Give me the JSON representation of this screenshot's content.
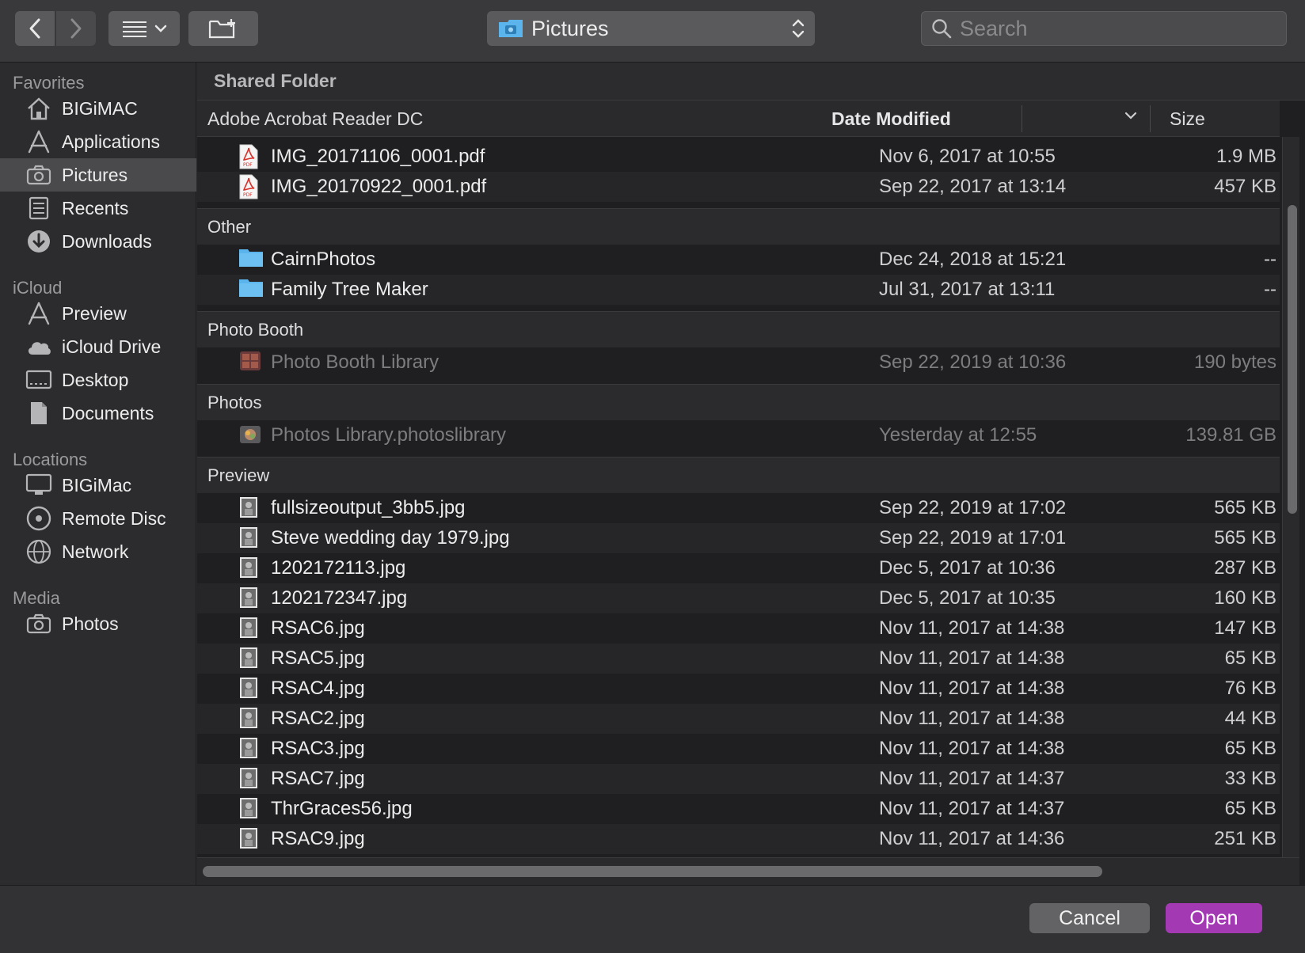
{
  "toolbar": {
    "path_label": "Pictures",
    "search_placeholder": "Search"
  },
  "sidebar": {
    "sections": [
      {
        "title": "Favorites",
        "items": [
          {
            "label": "BIGiMAC",
            "icon": "home-icon"
          },
          {
            "label": "Applications",
            "icon": "applications-icon"
          },
          {
            "label": "Pictures",
            "icon": "camera-icon",
            "selected": true
          },
          {
            "label": "Recents",
            "icon": "recents-icon"
          },
          {
            "label": "Downloads",
            "icon": "download-icon"
          }
        ]
      },
      {
        "title": "iCloud",
        "items": [
          {
            "label": "Preview",
            "icon": "applications-icon"
          },
          {
            "label": "iCloud Drive",
            "icon": "cloud-icon"
          },
          {
            "label": "Desktop",
            "icon": "desktop-icon"
          },
          {
            "label": "Documents",
            "icon": "document-icon"
          }
        ]
      },
      {
        "title": "Locations",
        "items": [
          {
            "label": "BIGiMac",
            "icon": "monitor-icon"
          },
          {
            "label": "Remote Disc",
            "icon": "disc-icon"
          },
          {
            "label": "Network",
            "icon": "globe-icon"
          }
        ]
      },
      {
        "title": "Media",
        "items": [
          {
            "label": "Photos",
            "icon": "camera-icon"
          }
        ]
      }
    ]
  },
  "main": {
    "location_header": "Shared Folder",
    "columns": {
      "name": "Adobe Acrobat Reader DC",
      "date": "Date Modified",
      "size": "Size"
    },
    "groups": [
      {
        "title": null,
        "rows": [
          {
            "name": "IMG_20171106_0001.pdf",
            "date": "Nov 6, 2017 at 10:55",
            "size": "1.9 MB",
            "icon": "pdf-icon"
          },
          {
            "name": "IMG_20170922_0001.pdf",
            "date": "Sep 22, 2017 at 13:14",
            "size": "457 KB",
            "icon": "pdf-icon"
          }
        ]
      },
      {
        "title": "Other",
        "rows": [
          {
            "name": "CairnPhotos",
            "date": "Dec 24, 2018 at 15:21",
            "size": "--",
            "icon": "folder-icon"
          },
          {
            "name": "Family Tree Maker",
            "date": "Jul 31, 2017 at 13:11",
            "size": "--",
            "icon": "folder-icon"
          }
        ]
      },
      {
        "title": "Photo Booth",
        "rows": [
          {
            "name": "Photo Booth Library",
            "date": "Sep 22, 2019 at 10:36",
            "size": "190 bytes",
            "icon": "photobooth-icon",
            "dim": true
          }
        ]
      },
      {
        "title": "Photos",
        "rows": [
          {
            "name": "Photos Library.photoslibrary",
            "date": "Yesterday at 12:55",
            "size": "139.81 GB",
            "icon": "photos-library-icon",
            "dim": true
          }
        ]
      },
      {
        "title": "Preview",
        "rows": [
          {
            "name": "fullsizeoutput_3bb5.jpg",
            "date": "Sep 22, 2019 at 17:02",
            "size": "565 KB",
            "icon": "image-thumb-icon"
          },
          {
            "name": "Steve wedding day 1979.jpg",
            "date": "Sep 22, 2019 at 17:01",
            "size": "565 KB",
            "icon": "image-thumb-icon"
          },
          {
            "name": "1202172113.jpg",
            "date": "Dec 5, 2017 at 10:36",
            "size": "287 KB",
            "icon": "image-thumb-icon"
          },
          {
            "name": "1202172347.jpg",
            "date": "Dec 5, 2017 at 10:35",
            "size": "160 KB",
            "icon": "image-thumb-icon"
          },
          {
            "name": "RSAC6.jpg",
            "date": "Nov 11, 2017 at 14:38",
            "size": "147 KB",
            "icon": "image-thumb-icon"
          },
          {
            "name": "RSAC5.jpg",
            "date": "Nov 11, 2017 at 14:38",
            "size": "65 KB",
            "icon": "image-thumb-icon"
          },
          {
            "name": "RSAC4.jpg",
            "date": "Nov 11, 2017 at 14:38",
            "size": "76 KB",
            "icon": "image-thumb-icon"
          },
          {
            "name": "RSAC2.jpg",
            "date": "Nov 11, 2017 at 14:38",
            "size": "44 KB",
            "icon": "image-thumb-icon"
          },
          {
            "name": "RSAC3.jpg",
            "date": "Nov 11, 2017 at 14:38",
            "size": "65 KB",
            "icon": "image-thumb-icon"
          },
          {
            "name": "RSAC7.jpg",
            "date": "Nov 11, 2017 at 14:37",
            "size": "33 KB",
            "icon": "image-thumb-icon"
          },
          {
            "name": "ThrGraces56.jpg",
            "date": "Nov 11, 2017 at 14:37",
            "size": "65 KB",
            "icon": "image-thumb-icon"
          },
          {
            "name": "RSAC9.jpg",
            "date": "Nov 11, 2017 at 14:36",
            "size": "251 KB",
            "icon": "image-thumb-icon"
          }
        ]
      }
    ]
  },
  "footer": {
    "cancel_label": "Cancel",
    "open_label": "Open"
  },
  "colors": {
    "accent": "#a33ab4",
    "folder": "#5bb4ec",
    "pdf": "#d8322b"
  }
}
